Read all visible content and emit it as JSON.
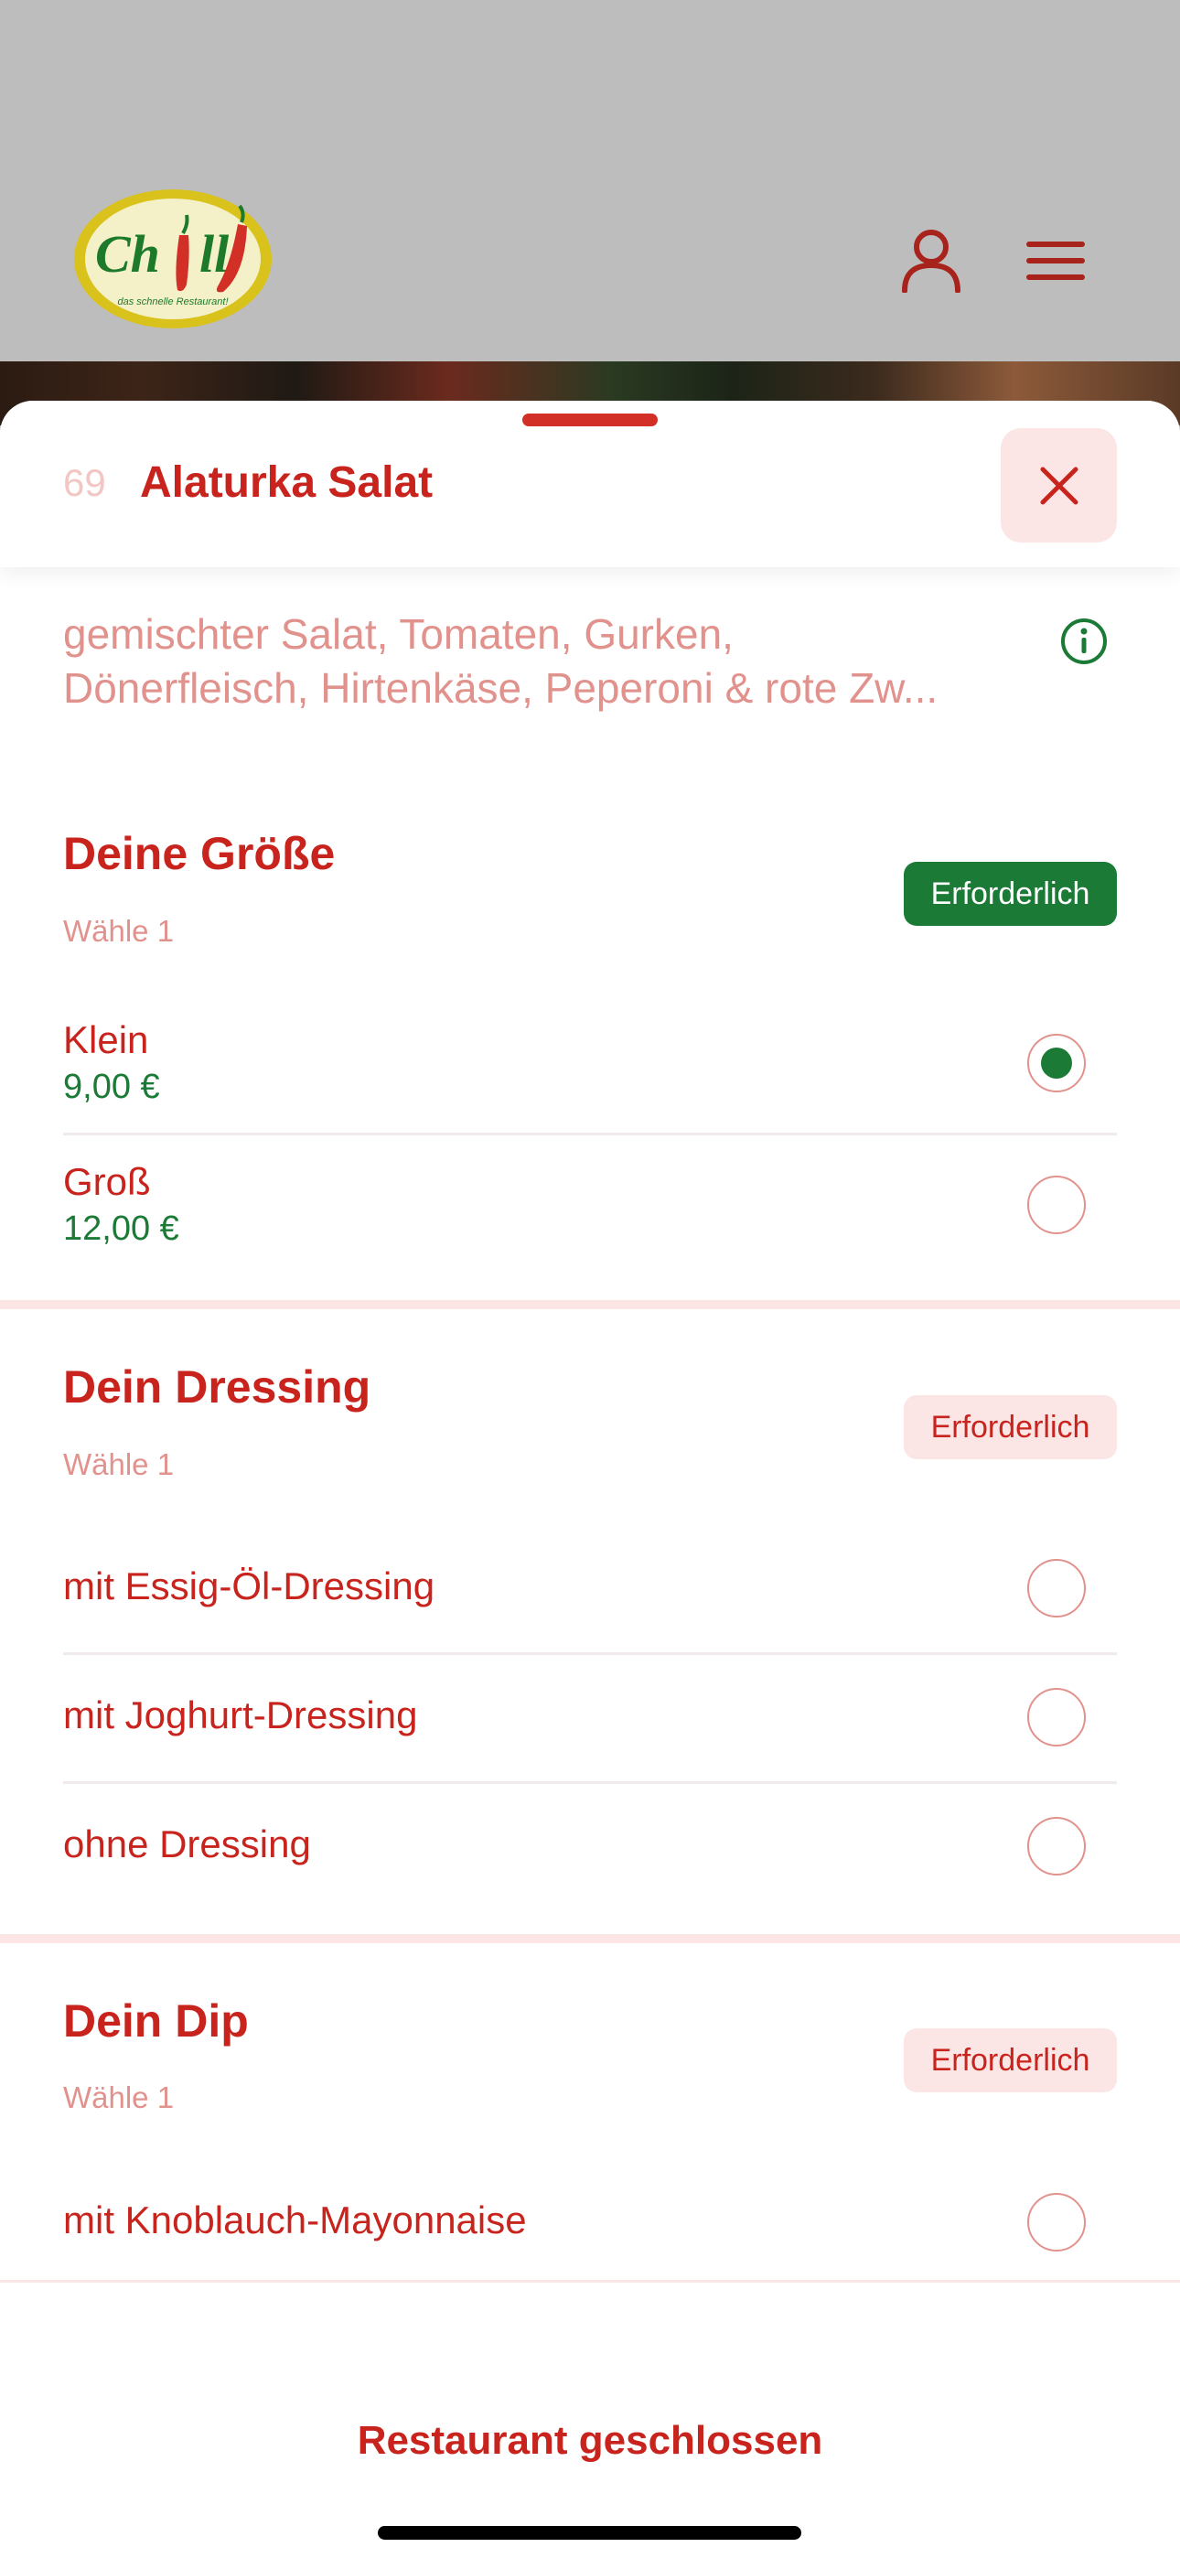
{
  "header": {
    "logo": {
      "wordmark": "Chilli",
      "tagline": "das schnelle Restaurant!"
    },
    "icons": [
      "user-icon",
      "menu-icon"
    ]
  },
  "product": {
    "number": "69",
    "title": "Alaturka Salat",
    "description_line1": "gemischter Salat, Tomaten, Gurken,",
    "description_line2": "Dönerfleisch, Hirtenkäse, Peperoni & rote Zw..."
  },
  "groups": [
    {
      "title": "Deine Größe",
      "subtitle": "Wähle 1",
      "badge": "Erforderlich",
      "options": [
        {
          "label": "Klein",
          "price": "9,00 €",
          "selected": true
        },
        {
          "label": "Groß",
          "price": "12,00 €",
          "selected": false
        }
      ]
    },
    {
      "title": "Dein Dressing",
      "subtitle": "Wähle 1",
      "badge": "Erforderlich",
      "options": [
        {
          "label": "mit Essig-Öl-Dressing",
          "selected": false
        },
        {
          "label": "mit Joghurt-Dressing",
          "selected": false
        },
        {
          "label": "ohne Dressing",
          "selected": false
        }
      ]
    },
    {
      "title": "Dein Dip",
      "subtitle": "Wähle 1",
      "badge": "Erforderlich",
      "options": [
        {
          "label": "mit Knoblauch-Mayonnaise",
          "selected": false
        }
      ]
    }
  ],
  "footer": {
    "status": "Restaurant geschlossen"
  },
  "colors": {
    "brand_red": "#c8241d",
    "green": "#1b7a35",
    "pink": "#fbe6e5",
    "muted": "#e2928d"
  }
}
